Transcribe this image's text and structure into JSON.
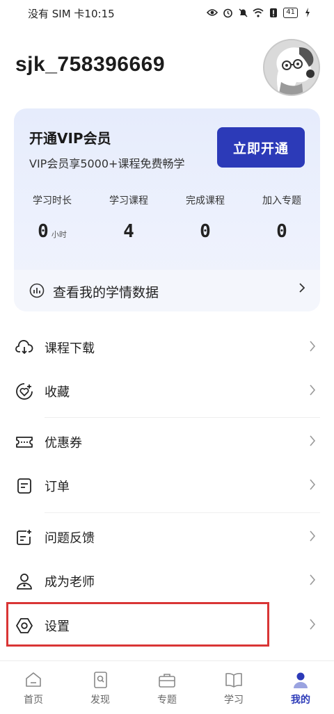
{
  "status_bar": {
    "left_text": "没有 SIM 卡10:15",
    "battery": "41",
    "icons": [
      "eye-icon",
      "alarm-icon",
      "mute-bell-icon",
      "wifi-icon",
      "alert-icon",
      "battery-icon",
      "charging-icon"
    ]
  },
  "profile": {
    "username": "sjk_758396669",
    "avatar": "dog-avatar"
  },
  "vip": {
    "title": "开通VIP会员",
    "subtitle": "VIP会员享5000+课程免费畅学",
    "button": "立即开通",
    "accent": "#2c3ab8",
    "stats": [
      {
        "label": "学习时长",
        "value": "0",
        "unit": "小时"
      },
      {
        "label": "学习课程",
        "value": "4",
        "unit": ""
      },
      {
        "label": "完成课程",
        "value": "0",
        "unit": ""
      },
      {
        "label": "加入专题",
        "value": "0",
        "unit": ""
      }
    ],
    "data_link": "查看我的学情数据"
  },
  "menu": [
    {
      "label": "课程下载",
      "icon": "cloud-download-icon"
    },
    {
      "label": "收藏",
      "icon": "favorite-heart-icon"
    },
    {
      "label": "优惠券",
      "icon": "coupon-icon"
    },
    {
      "label": "订单",
      "icon": "order-list-icon"
    },
    {
      "label": "问题反馈",
      "icon": "feedback-icon"
    },
    {
      "label": "成为老师",
      "icon": "teacher-icon"
    },
    {
      "label": "设置",
      "icon": "settings-icon"
    }
  ],
  "nav": [
    {
      "label": "首页",
      "icon": "home-icon",
      "active": false
    },
    {
      "label": "发现",
      "icon": "discover-icon",
      "active": false
    },
    {
      "label": "专题",
      "icon": "topic-briefcase-icon",
      "active": false
    },
    {
      "label": "学习",
      "icon": "study-book-icon",
      "active": false
    },
    {
      "label": "我的",
      "icon": "profile-icon",
      "active": true
    }
  ]
}
